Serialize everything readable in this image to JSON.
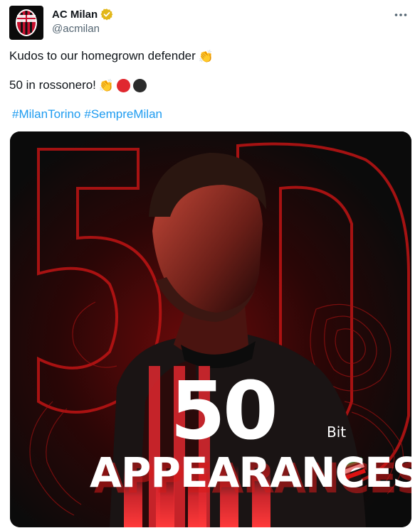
{
  "author": {
    "display_name": "AC Milan",
    "handle": "@acmilan"
  },
  "post": {
    "line1": "Kudos to our homegrown defender",
    "line1_emoji": "👏",
    "line2": "50 in rossonero!",
    "line2_emoji": "👏",
    "hashtags": [
      "#MilanTorino",
      "#SempreMilan"
    ]
  },
  "graphic": {
    "number": "50",
    "caption": "APPEARANCES",
    "sponsor": "Bit"
  },
  "icons": {
    "avatar": "ac-milan-crest",
    "verified": "gold-verified-badge",
    "more": "more-options-icon",
    "clap": "clapping-hands-emoji",
    "red_circle": "red-circle-emoji",
    "black_circle": "black-circle-emoji"
  },
  "colors": {
    "hashtag": "#1d9bf0",
    "verified_gold": "#e2b719",
    "milan_red": "#e0282f",
    "milan_black": "#2b2b2b",
    "secondary_text": "#536471"
  }
}
